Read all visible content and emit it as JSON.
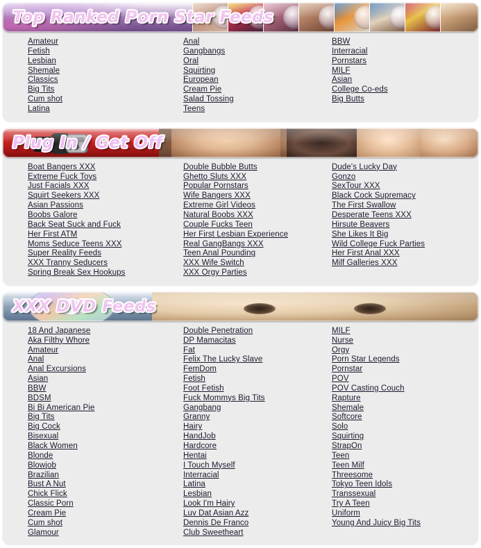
{
  "page": {
    "background_color": "#ffffff",
    "panel_color": "#ececec",
    "link_color": "#1a1a2e"
  },
  "sections": [
    {
      "id": "top-ranked-porn-star-feeds",
      "banner": {
        "title": "Top Ranked Porn Star Feeds",
        "style": "purple",
        "accent_color": "#9e79b3",
        "title_color": "#f0c2ef",
        "thumbnail_count": 8,
        "thumbnail_kind": "dvd-case"
      },
      "columns": [
        {
          "items": [
            "Amateur",
            "Fetish",
            "Lesbian",
            "Shemale",
            "Classics",
            "Big Tits",
            "Cum shot",
            "Latina"
          ]
        },
        {
          "items": [
            "Anal",
            "Gangbangs",
            "Oral",
            "Squirting",
            "European",
            "Cream Pie",
            "Salad Tossing",
            "Teens"
          ]
        },
        {
          "items": [
            "BBW",
            "Interracial",
            "Pornstars",
            "MILF",
            "Asian",
            "College Co-eds",
            "Big Butts"
          ]
        }
      ]
    },
    {
      "id": "plug-in-get-off",
      "banner": {
        "title": "Plug In / Get Off",
        "style": "red",
        "accent_color": "#c62222",
        "title_color": "#eebdf2",
        "graphic": "electrical-plug"
      },
      "columns": [
        {
          "items": [
            "Boat Bangers XXX",
            "Extreme Fuck Toys",
            "Just Facials XXX",
            "Squirt Seekers XXX",
            "Asian Passions",
            "Boobs Galore",
            "Back Seat Suck and Fuck",
            "Her First ATM",
            "Moms Seduce Teens XXX",
            "Super Reality Feeds",
            "XXX Tranny Seducers",
            "Spring Break Sex Hookups"
          ]
        },
        {
          "items": [
            "Double Bubble Butts",
            "Ghetto Sluts XXX",
            "Popular Pornstars",
            "Wife Bangers XXX",
            "Extreme Girl Videos",
            "Natural Boobs XXX",
            "Couple Fucks Teen",
            "Her First Lesbian Experience",
            "Real GangBangs XXX",
            "Teen Anal Pounding",
            "XXX Wife Switch",
            "XXX Orgy Parties"
          ]
        },
        {
          "items": [
            "Dude's Lucky Day",
            "Gonzo",
            "SexTour XXX",
            "Black Cock Supremacy",
            "The First Swallow",
            "Desperate Teens XXX",
            "Hirsute Beavers",
            "She Likes It Big",
            "Wild College Fuck Parties",
            "Her First Anal XXX",
            "Milf Galleries XXX"
          ]
        }
      ]
    },
    {
      "id": "xxx-dvd-feeds",
      "banner": {
        "title": "XXX DVD Feeds",
        "style": "steel-blue",
        "accent_color": "#8ea4ba",
        "title_color": "#f0c3f0",
        "graphic": "dvd-disc"
      },
      "columns": [
        {
          "items": [
            "18 And Japanese",
            "Aka Filthy Whore",
            "Amateur",
            "Anal",
            "Anal Excursions",
            "Asian",
            "BBW",
            "BDSM",
            "Bi Bi American Pie",
            "Big Tits",
            "Big Cock",
            "Bisexual",
            "Black Women",
            "Blonde",
            "Blowjob",
            "Brazilian",
            "Bust A Nut",
            "Chick Flick",
            "Classic Porn",
            "Cream Pie",
            "Cum shot",
            "Glamour"
          ]
        },
        {
          "items": [
            "Double Penetration",
            "DP Mamacitas",
            "Fat",
            "Felix The Lucky Slave",
            "FemDom",
            "Fetish",
            "Foot Fetish",
            "Fuck Mommys Big Tits",
            "Gangbang",
            "Granny",
            "Hairy",
            "HandJob",
            "Hardcore",
            "Hentai",
            "I Touch Myself",
            "Interracial",
            "Latina",
            "Lesbian",
            "Look I'm Hairy",
            "Luv Dat Asian Azz",
            "Dennis De Franco",
            "Club Sweetheart"
          ]
        },
        {
          "items": [
            "MILF",
            "Nurse",
            "Orgy",
            "Porn Star Legends",
            "Pornstar",
            "POV",
            "POV Casting Couch",
            "Rapture",
            "Shemale",
            "Softcore",
            "Solo",
            "Squirting",
            "StrapOn",
            "Teen",
            "Teen Milf",
            "Threesome",
            "Tokyo Teen Idols",
            "Transsexual",
            "Try A Teen",
            "Uniform",
            "Young And Juicy Big Tits"
          ]
        }
      ]
    }
  ]
}
